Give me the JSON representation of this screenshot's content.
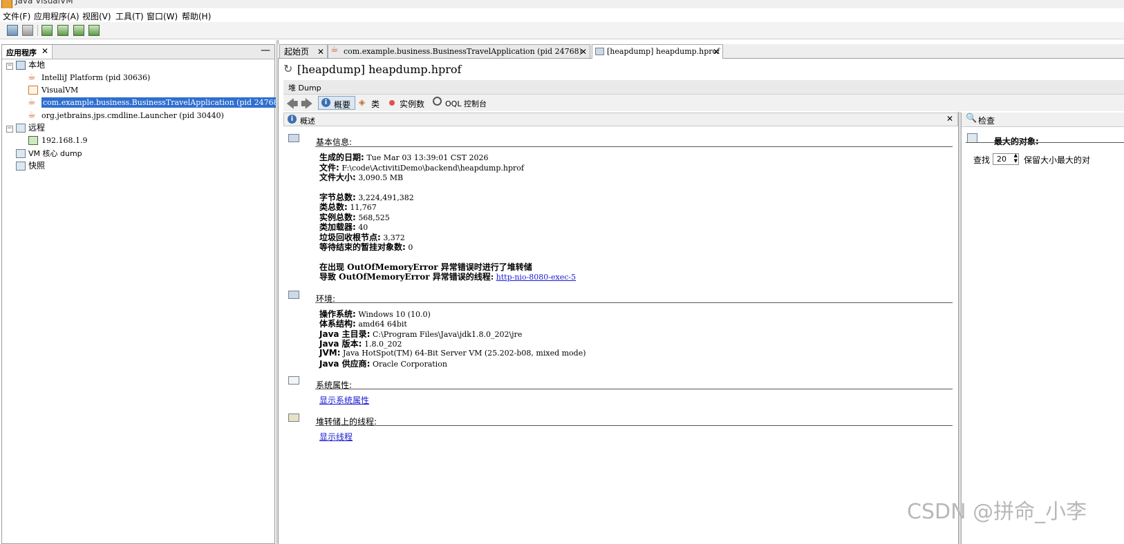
{
  "window": {
    "title": "Java VisualVM"
  },
  "menu": [
    "文件(F)",
    "应用程序(A)",
    "视图(V)",
    "工具(T)",
    "窗口(W)",
    "帮助(H)"
  ],
  "left_panel": {
    "tab_label": "应用程序",
    "tree": {
      "local": "本地",
      "local_items": [
        "IntelliJ Platform (pid 30636)",
        "VisualVM",
        "com.example.business.BusinessTravelApplication (pid 24768)",
        "org.jetbrains.jps.cmdline.Launcher (pid 30440)"
      ],
      "remote": "远程",
      "remote_items": [
        "192.168.1.9"
      ],
      "vm_core": "VM 核心 dump",
      "snapshot": "快照"
    }
  },
  "doc_tabs": [
    "起始页",
    "com.example.business.BusinessTravelApplication (pid 24768)",
    "[heapdump] heapdump.hprof"
  ],
  "heap": {
    "title": "[heapdump] heapdump.hprof",
    "subbar_label": "堆 Dump",
    "nav": {
      "summary": "概要",
      "classes": "类",
      "instances": "实例数",
      "oql": "OQL 控制台"
    },
    "overview_label": "概述",
    "basic": {
      "title": "基本信息:",
      "date_label": "生成的日期:",
      "date": "Tue Mar 03 13:39:01 CST 2026",
      "file_label": "文件:",
      "file": "F:\\code\\ActivitiDemo\\backend\\heapdump.hprof",
      "size_label": "文件大小:",
      "size": "3,090.5 MB",
      "bytes_label": "字节总数:",
      "bytes": "3,224,491,382",
      "classes_label": "类总数:",
      "classes": "11,767",
      "instances_label": "实例总数:",
      "instances": "568,525",
      "loaders_label": "类加载器:",
      "loaders": "40",
      "gcroots_label": "垃圾回收根节点:",
      "gcroots": "3,372",
      "pending_label": "等待结束的暂挂对象数:",
      "pending": "0",
      "oom_line": "在出现 OutOfMemoryError 异常错误时进行了堆转储",
      "oom_thread_label": "导致 OutOfMemoryError 异常错误的线程:",
      "oom_thread": "http-nio-8080-exec-5"
    },
    "env": {
      "title": "环境:",
      "os_label": "操作系统:",
      "os": "Windows 10 (10.0)",
      "arch_label": "体系结构:",
      "arch": "amd64 64bit",
      "home_label": "Java 主目录:",
      "home": "C:\\Program Files\\Java\\jdk1.8.0_202\\jre",
      "ver_label": "Java 版本:",
      "ver": "1.8.0_202",
      "jvm_label": "JVM:",
      "jvm": "Java HotSpot(TM) 64-Bit Server VM (25.202-b08, mixed mode)",
      "vendor_label": "Java 供应商:",
      "vendor": "Oracle Corporation"
    },
    "sysprops": {
      "title": "系统属性:",
      "link": "显示系统属性"
    },
    "threads": {
      "title": "堆转储上的线程:",
      "link": "显示线程"
    }
  },
  "inspect": {
    "label": "检查",
    "largest": "最大的对象:",
    "find_label": "查找",
    "count": "20",
    "retain_label": "保留大小最大的对"
  },
  "watermark": "CSDN @拼命_小李"
}
